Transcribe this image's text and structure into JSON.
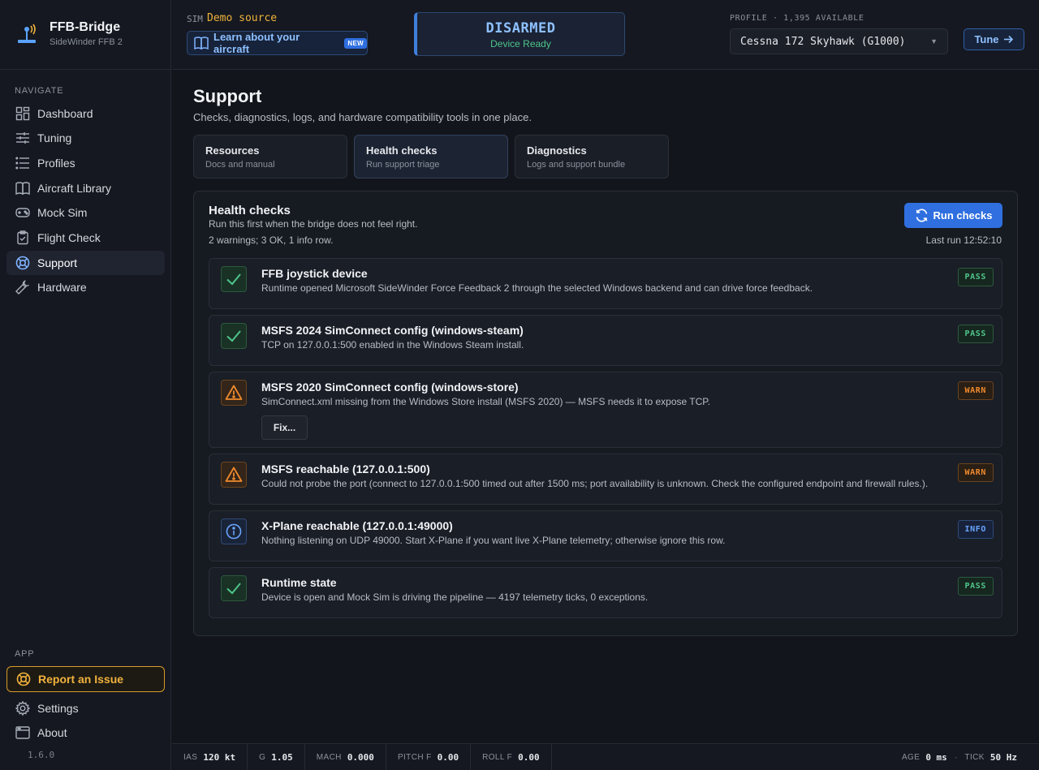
{
  "app": {
    "title": "FFB-Bridge",
    "subtitle": "SideWinder FFB 2",
    "version": "1.6.0"
  },
  "sidebar": {
    "navigate_label": "NAVIGATE",
    "items": [
      {
        "label": "Dashboard",
        "icon": "grid-icon"
      },
      {
        "label": "Tuning",
        "icon": "sliders-icon"
      },
      {
        "label": "Profiles",
        "icon": "list-icon"
      },
      {
        "label": "Aircraft Library",
        "icon": "book-icon"
      },
      {
        "label": "Mock Sim",
        "icon": "gamepad-icon"
      },
      {
        "label": "Flight Check",
        "icon": "clipboard-check-icon"
      },
      {
        "label": "Support",
        "icon": "lifebuoy-icon",
        "active": true
      },
      {
        "label": "Hardware",
        "icon": "wrench-icon"
      }
    ],
    "app_label": "APP",
    "report_issue": "Report an Issue",
    "settings": "Settings",
    "about": "About"
  },
  "topbar": {
    "sim_label": "SIM",
    "sim_value": "Demo source",
    "learn_label": "Learn about your aircraft",
    "learn_badge": "NEW",
    "status_main": "DISARMED",
    "status_sub": "Device Ready",
    "profile_label": "PROFILE · 1,395 AVAILABLE",
    "profile_value": "Cessna 172 Skyhawk (G1000)",
    "tune_label": "Tune"
  },
  "page": {
    "title": "Support",
    "description": "Checks, diagnostics, logs, and hardware compatibility tools in one place."
  },
  "tabs": [
    {
      "title": "Resources",
      "sub": "Docs and manual"
    },
    {
      "title": "Health checks",
      "sub": "Run support triage",
      "active": true
    },
    {
      "title": "Diagnostics",
      "sub": "Logs and support bundle"
    }
  ],
  "panel": {
    "title": "Health checks",
    "description": "Run this first when the bridge does not feel right.",
    "summary": "2 warnings; 3 OK, 1 info row.",
    "run_label": "Run checks",
    "last_run": "Last run 12:52:10"
  },
  "checks": [
    {
      "title": "FFB joystick device",
      "desc": "Runtime opened Microsoft SideWinder Force Feedback 2 through the selected Windows backend and can drive force feedback.",
      "status": "PASS"
    },
    {
      "title": "MSFS 2024 SimConnect config (windows-steam)",
      "desc": "TCP on 127.0.0.1:500 enabled in the Windows Steam install.",
      "status": "PASS"
    },
    {
      "title": "MSFS 2020 SimConnect config (windows-store)",
      "desc": "SimConnect.xml missing from the Windows Store install (MSFS 2020) — MSFS needs it to expose TCP.",
      "status": "WARN",
      "action": "Fix..."
    },
    {
      "title": "MSFS reachable (127.0.0.1:500)",
      "desc": "Could not probe the port (connect to 127.0.0.1:500 timed out after 1500 ms; port availability is unknown. Check the configured endpoint and firewall rules.).",
      "status": "WARN"
    },
    {
      "title": "X-Plane reachable (127.0.0.1:49000)",
      "desc": "Nothing listening on UDP 49000. Start X-Plane if you want live X-Plane telemetry; otherwise ignore this row.",
      "status": "INFO"
    },
    {
      "title": "Runtime state",
      "desc": "Device is open and Mock Sim is driving the pipeline — 4197 telemetry ticks, 0 exceptions.",
      "status": "PASS"
    }
  ],
  "telemetry": {
    "ias_label": "IAS",
    "ias_value": "120 kt",
    "g_label": "G",
    "g_value": "1.05",
    "mach_label": "MACH",
    "mach_value": "0.000",
    "pitch_label": "PITCH F",
    "pitch_value": "0.00",
    "roll_label": "ROLL F",
    "roll_value": "0.00",
    "age_label": "AGE",
    "age_value": "0 ms",
    "tick_label": "TICK",
    "tick_value": "50 Hz"
  },
  "colors": {
    "accent": "#2f6fe0",
    "pass": "#4fc48a",
    "warn": "#f08a2c",
    "info": "#6aa5ff",
    "sim_source": "#f0b23c"
  }
}
